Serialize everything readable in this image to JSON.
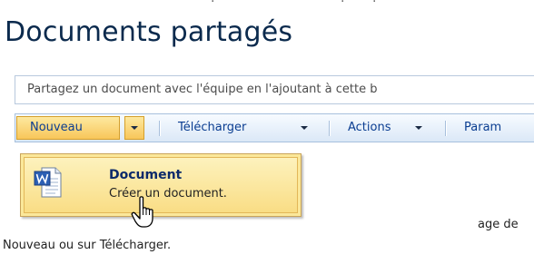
{
  "page": {
    "title": "Documents partagés",
    "description": "Partagez un document avec l'équipe en l'ajoutant à cette b"
  },
  "toolbar": {
    "items": [
      {
        "label": "Nouveau",
        "icon": "chevron-down-icon",
        "highlighted": true
      },
      {
        "label": "Télécharger",
        "icon": "chevron-down-icon"
      },
      {
        "label": "Actions",
        "icon": "chevron-down-icon"
      },
      {
        "label": "Param"
      }
    ]
  },
  "menu": {
    "items": [
      {
        "icon": "word-document-icon",
        "title": "Document",
        "description": "Créer un document."
      }
    ]
  },
  "body": {
    "line1_fragment": "age de",
    "line2": "Nouveau ou sur Télécharger."
  },
  "colors": {
    "title": "#0b2a4d",
    "toolbar_text": "#0a3d91",
    "highlight": "#fbe89a",
    "toolbar_border": "#a7c0dd"
  },
  "cursor": "hand-pointer-icon"
}
